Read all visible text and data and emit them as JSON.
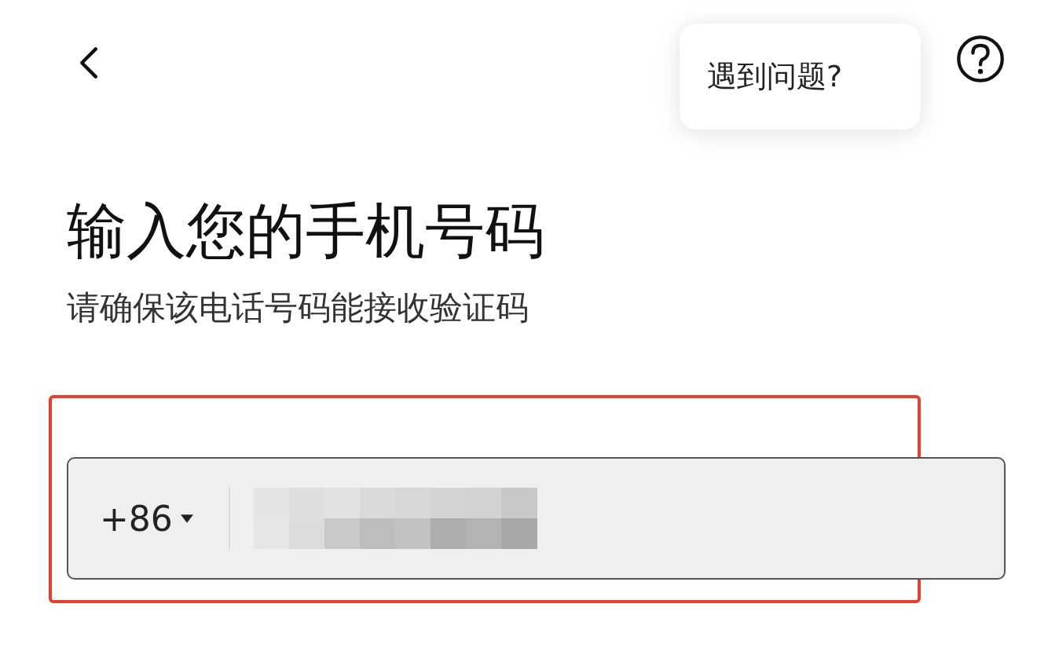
{
  "help_tooltip": {
    "text": "遇到问题?"
  },
  "title": "输入您的手机号码",
  "subtitle": "请确保该电话号码能接收验证码",
  "phone_field": {
    "country_code": "+86"
  }
}
